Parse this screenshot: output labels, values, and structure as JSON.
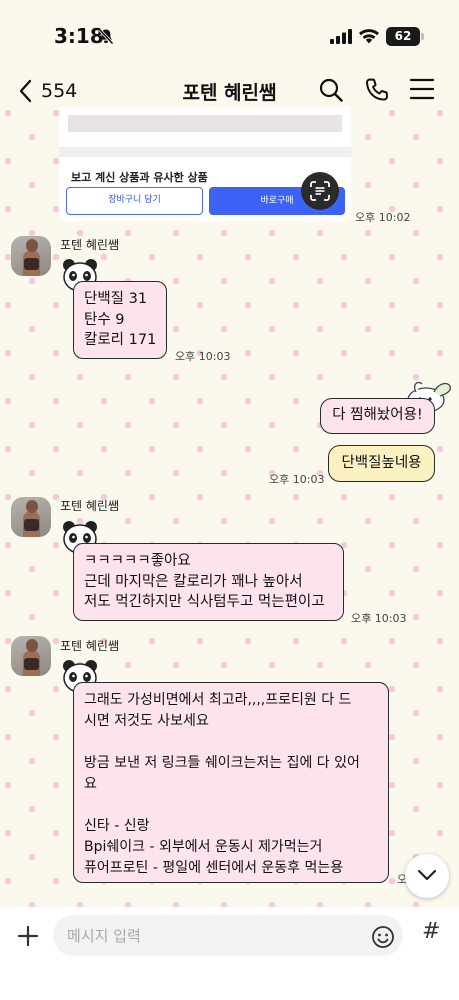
{
  "status_bar": {
    "time": "3:18",
    "battery": "62"
  },
  "nav": {
    "back_count": "554",
    "title": "포텐 혜린쌤"
  },
  "shared_card": {
    "heading": "보고 계신 상품과 유사한 상품",
    "cart_label": "장바구니 담기",
    "buy_label": "바로구매",
    "time": "오후 10:02"
  },
  "messages": [
    {
      "sender": "포텐 혜린쌤",
      "lines": [
        "단백질 31",
        "탄수 9",
        "칼로리 171"
      ],
      "time": "오후 10:03"
    },
    {
      "outgoing": [
        "다 찜해놨어용!",
        "단백질높네용"
      ],
      "time": "오후 10:03"
    },
    {
      "sender": "포텐 혜린쌤",
      "lines": [
        "ㅋㅋㅋㅋㅋ좋아요",
        "근데 마지막은 칼로리가 꽤나 높아서",
        "저도 먹긴하지만 식사텀두고 먹는편이고"
      ],
      "time": "오후 10:03"
    },
    {
      "sender": "포텐 혜린쌤",
      "lines": [
        "그래도 가성비면에서 최고라,,,,프로티원 다 드",
        "시면 저것도 사보세요",
        "",
        "방금 보낸 저 링크들 쉐이크는저는 집에 다 있어",
        "요",
        "",
        "신타 - 신랑",
        "Bpi쉐이크 - 외부에서 운동시 제가먹는거",
        "퓨어프로틴 - 평일에 센터에서 운동후 먹는용"
      ],
      "time": "오"
    }
  ],
  "input": {
    "placeholder": "메시지 입력"
  },
  "colors": {
    "incoming_bubble": "#fde3ee",
    "outgoing_pink": "#fde3ee",
    "outgoing_yellow": "#fcf1c0",
    "buy_button": "#3c63f5"
  }
}
